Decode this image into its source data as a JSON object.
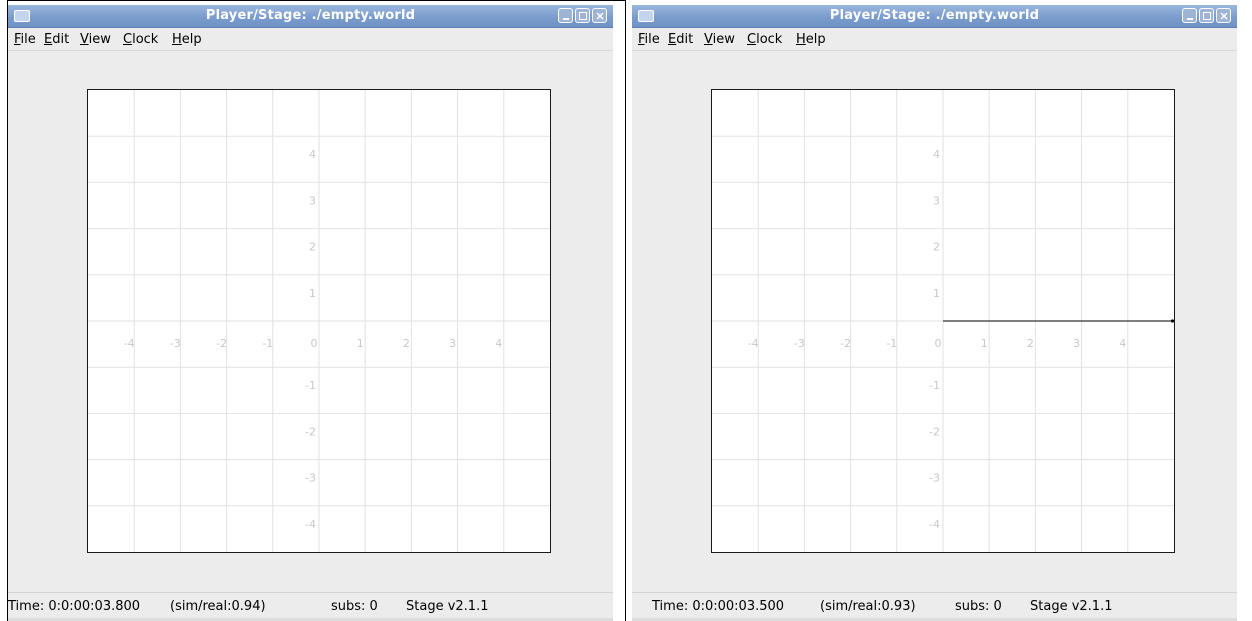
{
  "windows": [
    {
      "title": "Player/Stage: ./empty.world",
      "menu": [
        {
          "mnemonic": "F",
          "rest": "ile"
        },
        {
          "mnemonic": "E",
          "rest": "dit"
        },
        {
          "mnemonic": "V",
          "rest": "iew"
        },
        {
          "mnemonic": "C",
          "rest": "lock"
        },
        {
          "mnemonic": "H",
          "rest": "elp"
        }
      ],
      "grid": {
        "x_labels": [
          "-4",
          "-3",
          "-2",
          "-1",
          "0",
          "1",
          "2",
          "3",
          "4"
        ],
        "y_labels": [
          "4",
          "3",
          "2",
          "1",
          "-1",
          "-2",
          "-3",
          "-4"
        ],
        "range": [
          -5,
          5
        ],
        "ray": null
      },
      "status": {
        "time": "Time: 0:0:00:03.800",
        "sim_real": "(sim/real:0.94)",
        "subs": "subs: 0",
        "version": "Stage v2.1.1"
      }
    },
    {
      "title": "Player/Stage: ./empty.world",
      "menu": [
        {
          "mnemonic": "F",
          "rest": "ile"
        },
        {
          "mnemonic": "E",
          "rest": "dit"
        },
        {
          "mnemonic": "V",
          "rest": "iew"
        },
        {
          "mnemonic": "C",
          "rest": "lock"
        },
        {
          "mnemonic": "H",
          "rest": "elp"
        }
      ],
      "grid": {
        "x_labels": [
          "-4",
          "-3",
          "-2",
          "-1",
          "0",
          "1",
          "2",
          "3",
          "4"
        ],
        "y_labels": [
          "4",
          "3",
          "2",
          "1",
          "-1",
          "-2",
          "-3",
          "-4"
        ],
        "range": [
          -5,
          5
        ],
        "ray": {
          "from": [
            0,
            0
          ],
          "to": [
            5,
            0
          ]
        }
      },
      "status": {
        "time": "Time: 0:0:00:03.500",
        "sim_real": "(sim/real:0.93)",
        "subs": "subs: 0",
        "version": "Stage v2.1.1"
      }
    }
  ],
  "colors": {
    "gridline": "#e2e2e2",
    "grid_label": "#c8c8c8",
    "ray": "#333333"
  }
}
